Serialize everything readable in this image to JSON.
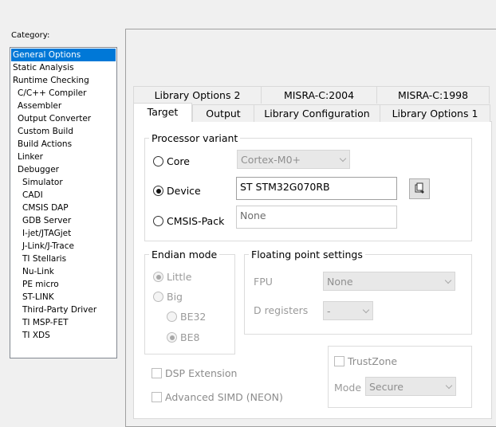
{
  "category": {
    "label": "Category:",
    "items": [
      {
        "label": "General Options",
        "selected": true,
        "level": 0
      },
      {
        "label": "Static Analysis",
        "level": 0
      },
      {
        "label": "Runtime Checking",
        "level": 0
      },
      {
        "label": "C/C++ Compiler",
        "level": 1
      },
      {
        "label": "Assembler",
        "level": 1
      },
      {
        "label": "Output Converter",
        "level": 1
      },
      {
        "label": "Custom Build",
        "level": 1
      },
      {
        "label": "Build Actions",
        "level": 1
      },
      {
        "label": "Linker",
        "level": 1
      },
      {
        "label": "Debugger",
        "level": 1
      },
      {
        "label": "Simulator",
        "level": 2
      },
      {
        "label": "CADI",
        "level": 2
      },
      {
        "label": "CMSIS DAP",
        "level": 2
      },
      {
        "label": "GDB Server",
        "level": 2
      },
      {
        "label": "I-jet/JTAGjet",
        "level": 2
      },
      {
        "label": "J-Link/J-Trace",
        "level": 2
      },
      {
        "label": "TI Stellaris",
        "level": 2
      },
      {
        "label": "Nu-Link",
        "level": 2
      },
      {
        "label": "PE micro",
        "level": 2
      },
      {
        "label": "ST-LINK",
        "level": 2
      },
      {
        "label": "Third-Party Driver",
        "level": 2
      },
      {
        "label": "TI MSP-FET",
        "level": 2
      },
      {
        "label": "TI XDS",
        "level": 2
      }
    ]
  },
  "tabs": {
    "row_back": [
      "Library Options 2",
      "MISRA-C:2004",
      "MISRA-C:1998"
    ],
    "row_front": [
      "Target",
      "Output",
      "Library Configuration",
      "Library Options 1"
    ],
    "active": "Target"
  },
  "processor": {
    "title": "Processor variant",
    "core": {
      "label": "Core",
      "value": "Cortex-M0+",
      "selected": false
    },
    "device": {
      "label": "Device",
      "value": "ST STM32G070RB",
      "selected": true
    },
    "cmsis": {
      "label": "CMSIS-Pack",
      "value": "None",
      "selected": false
    }
  },
  "endian": {
    "title": "Endian mode",
    "little": "Little",
    "big": "Big",
    "be32": "BE32",
    "be8": "BE8"
  },
  "fp": {
    "title": "Floating point settings",
    "fpu_label": "FPU",
    "fpu_value": "None",
    "dreg_label": "D registers",
    "dreg_value": "-"
  },
  "trustzone": {
    "label": "TrustZone",
    "mode_label": "Mode",
    "mode_value": "Secure"
  },
  "dsp_label": "DSP Extension",
  "simd_label": "Advanced SIMD (NEON)",
  "icons": {
    "browse": "device-browse-icon"
  }
}
